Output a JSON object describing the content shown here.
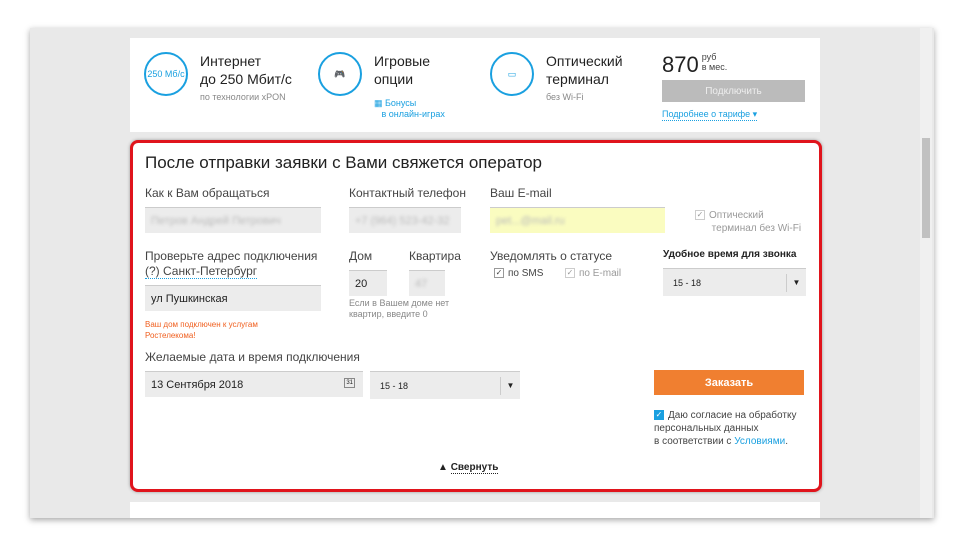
{
  "tariff": {
    "features": [
      {
        "icon": "speedometer-icon",
        "icon_text": "250 Мб/с",
        "title": [
          "Интернет",
          "до 250 Мбит/с"
        ],
        "sub": "по технологии xPON"
      },
      {
        "icon": "gamepad-icon",
        "title": [
          "Игровые",
          "опции"
        ],
        "link": [
          "Бонусы",
          "в онлайн-играх"
        ]
      },
      {
        "icon": "router-icon",
        "title": [
          "Оптический",
          "терминал"
        ],
        "sub": "без Wi-Fi"
      }
    ],
    "price": "870",
    "currency": "руб",
    "period": "в мес.",
    "connect_label": "Подключить",
    "more_label": "Подробнее о тарифе ▾"
  },
  "form": {
    "title": "После отправки заявки с Вами свяжется оператор",
    "name_label": "Как к Вам обращаться",
    "name_value": "Петров Андрей Петрович",
    "phone_label": "Контактный телефон",
    "phone_value": "+7 (964) 523-42-32",
    "email_label": "Ваш E-mail",
    "email_value": "pet...@mail.ru",
    "terminal_label": [
      "Оптический",
      "терминал без Wi-Fi"
    ],
    "address_label": "Проверьте адрес подключения",
    "city_link": "(?) Санкт-Петербург",
    "street_value": "ул Пушкинская",
    "connected_note": [
      "Ваш дом подключен к услугам",
      "Ростелекома!"
    ],
    "house_label": "Дом",
    "house_value": "20",
    "flat_label": "Квартира",
    "flat_value": "47",
    "flat_hint": [
      "Если в Вашем доме нет",
      "квартир, введите 0"
    ],
    "notify_label": "Уведомлять о статусе",
    "notify_sms": "по SMS",
    "notify_email": "по E-mail",
    "call_time_label": "Удобное время для звонка",
    "call_time_value": "15 - 18",
    "date_label": "Желаемые дата и время подключения",
    "date_value": "13 Сентября 2018",
    "calendar_day": "31",
    "time_value": "15 - 18",
    "order_label": "Заказать",
    "consent": [
      "Даю согласие на обработку",
      "персональных данных",
      "в соответствии с "
    ],
    "consent_link": "Условиями",
    "consent_end": ".",
    "collapse_label": "Свернуть"
  },
  "colors": {
    "accent": "#1aa0e0",
    "order": "#f07f30",
    "highlight": "#e0141c"
  }
}
